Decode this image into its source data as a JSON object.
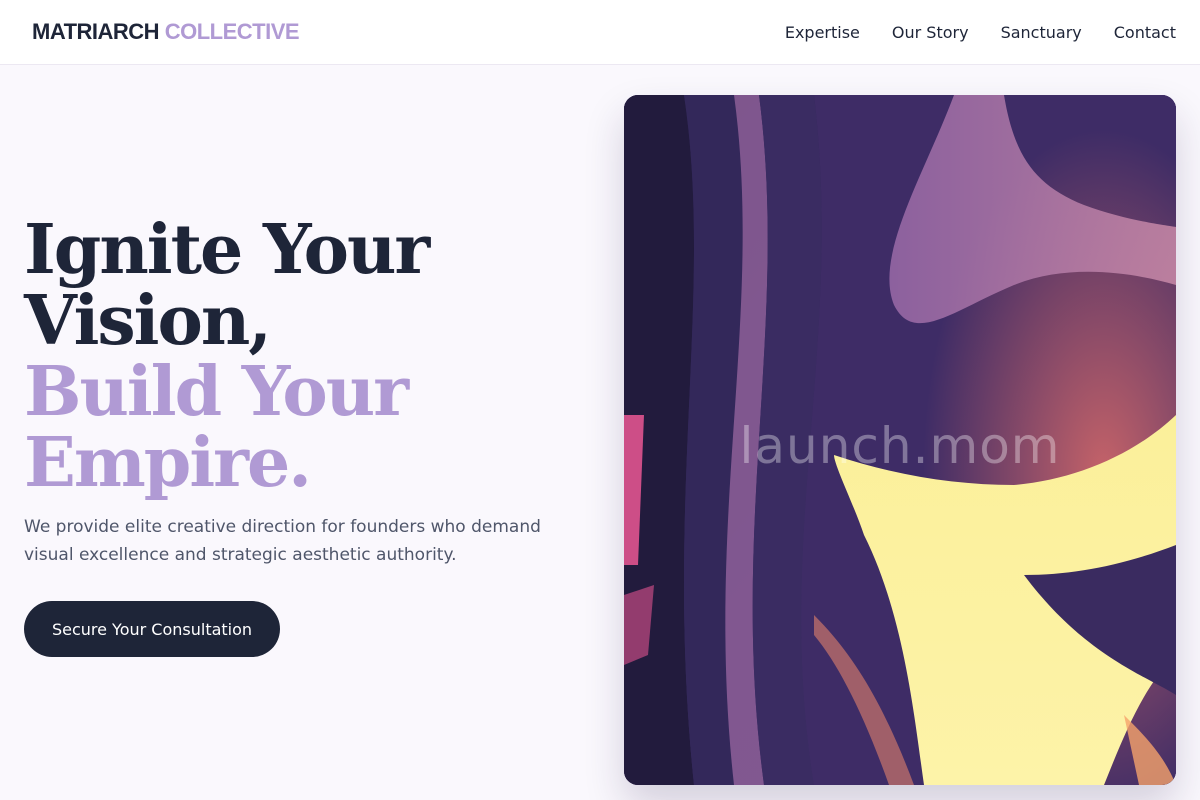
{
  "brand": {
    "name_primary": "MATRIARCH",
    "name_accent": "COLLECTIVE"
  },
  "nav": {
    "items": [
      "Expertise",
      "Our Story",
      "Sanctuary",
      "Contact"
    ]
  },
  "hero": {
    "headline_line1": "Ignite Your",
    "headline_line2": "Vision,",
    "headline_line3": "Build Your",
    "headline_line4": "Empire.",
    "subtext": "We provide elite creative direction for founders who demand visual excellence and strategic aesthetic authority.",
    "cta_label": "Secure Your Consultation"
  },
  "artwork": {
    "watermark": "launch.mom"
  },
  "colors": {
    "ink": "#1e2538",
    "accent": "#b09ad4",
    "background": "#faf8fd",
    "art_purple": "#3a2a60",
    "art_yellow": "#fbf09a",
    "art_pink": "#e0548f"
  }
}
